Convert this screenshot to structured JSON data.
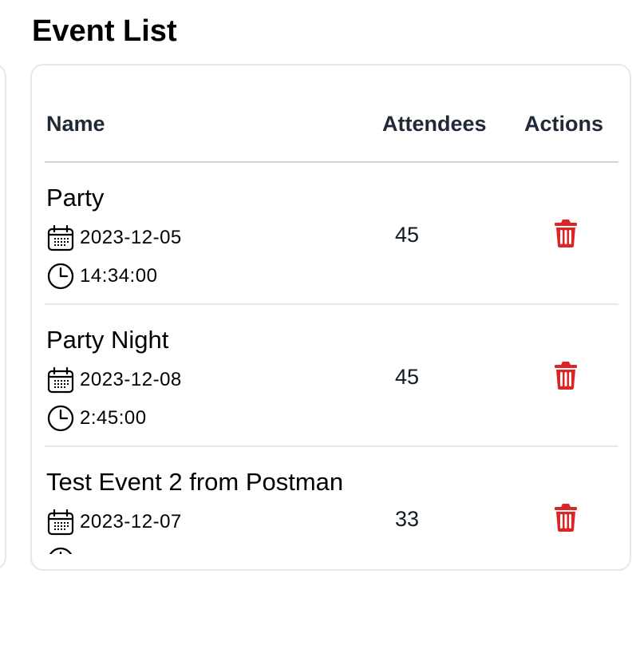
{
  "page": {
    "title": "Event List"
  },
  "table": {
    "headers": {
      "name": "Name",
      "attendees": "Attendees",
      "actions": "Actions"
    },
    "rows": [
      {
        "name": "Party",
        "date": "2023-12-05",
        "time": "14:34:00",
        "attendees": "45",
        "action_icon": "trash-icon"
      },
      {
        "name": "Party Night",
        "date": "2023-12-08",
        "time": "2:45:00",
        "attendees": "45",
        "action_icon": "trash-icon"
      },
      {
        "name": "Test Event 2 from Postman",
        "date": "2023-12-07",
        "time": "",
        "attendees": "33",
        "action_icon": "trash-icon"
      }
    ]
  },
  "colors": {
    "delete_action": "#dc2626",
    "border": "#e5e7eb",
    "header_text": "#1f2937"
  },
  "icons": {
    "date": "calendar-icon",
    "time": "clock-icon",
    "delete": "trash-icon"
  }
}
